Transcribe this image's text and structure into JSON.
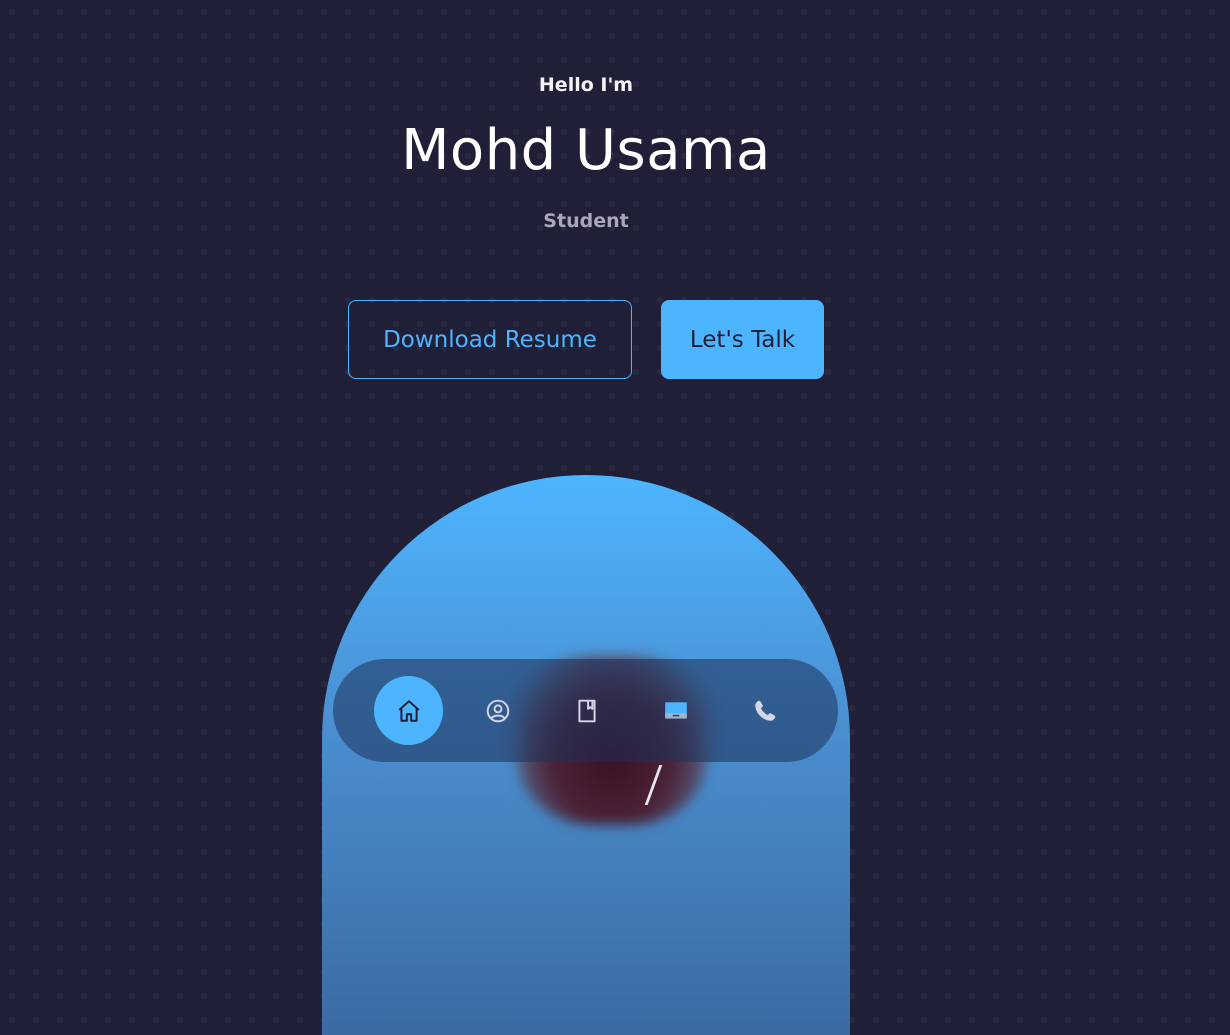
{
  "hero": {
    "greeting": "Hello I'm",
    "name": "Mohd Usama",
    "role": "Student"
  },
  "buttons": {
    "download_resume": "Download Resume",
    "lets_talk": "Let's Talk"
  },
  "nav": {
    "items": [
      {
        "icon": "home-icon",
        "active": true
      },
      {
        "icon": "user-icon",
        "active": false
      },
      {
        "icon": "book-icon",
        "active": false
      },
      {
        "icon": "laptop-icon",
        "active": false
      },
      {
        "icon": "phone-icon",
        "active": false
      }
    ]
  },
  "colors": {
    "background": "#1f1f38",
    "accent": "#4db5ff",
    "text_light": "#a8a8b8"
  }
}
